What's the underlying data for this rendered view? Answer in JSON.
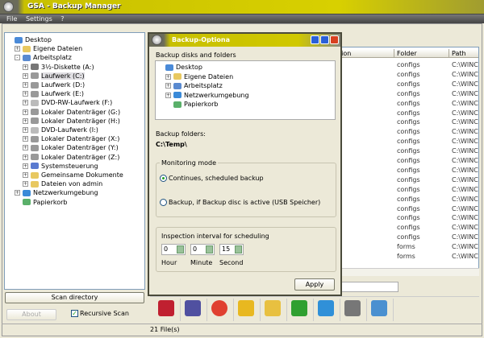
{
  "window": {
    "title": "GSA - Backup Manager"
  },
  "menu": [
    "File",
    "Settings",
    "?"
  ],
  "tree": [
    {
      "label": "Desktop",
      "level": 0,
      "expander": "",
      "icon": "desktop-icon",
      "color": "#4a8ad8"
    },
    {
      "label": "Eigene Dateien",
      "level": 1,
      "expander": "+",
      "icon": "folder-icon",
      "color": "#e8c860"
    },
    {
      "label": "Arbeitsplatz",
      "level": 1,
      "expander": "-",
      "icon": "computer-icon",
      "color": "#5a8ad0"
    },
    {
      "label": "3½-Diskette (A:)",
      "level": 2,
      "expander": "+",
      "icon": "floppy-icon",
      "color": "#777"
    },
    {
      "label": "Laufwerk (C:)",
      "level": 2,
      "expander": "+",
      "icon": "drive-icon",
      "color": "#999",
      "selected": true
    },
    {
      "label": "Laufwerk (D:)",
      "level": 2,
      "expander": "+",
      "icon": "drive-icon",
      "color": "#999"
    },
    {
      "label": "Laufwerk (E:)",
      "level": 2,
      "expander": "+",
      "icon": "drive-icon",
      "color": "#999"
    },
    {
      "label": "DVD-RW-Laufwerk (F:)",
      "level": 2,
      "expander": "+",
      "icon": "dvd-icon",
      "color": "#bbb"
    },
    {
      "label": "Lokaler Datenträger (G:)",
      "level": 2,
      "expander": "+",
      "icon": "drive-icon",
      "color": "#999"
    },
    {
      "label": "Lokaler Datenträger (H:)",
      "level": 2,
      "expander": "+",
      "icon": "drive-icon",
      "color": "#999"
    },
    {
      "label": "DVD-Laufwerk (I:)",
      "level": 2,
      "expander": "+",
      "icon": "dvd-icon",
      "color": "#bbb"
    },
    {
      "label": "Lokaler Datenträger (X:)",
      "level": 2,
      "expander": "+",
      "icon": "drive-icon",
      "color": "#999"
    },
    {
      "label": "Lokaler Datenträger (Y:)",
      "level": 2,
      "expander": "+",
      "icon": "drive-icon",
      "color": "#999"
    },
    {
      "label": "Lokaler Datenträger (Z:)",
      "level": 2,
      "expander": "+",
      "icon": "drive-icon",
      "color": "#999"
    },
    {
      "label": "Systemsteuerung",
      "level": 2,
      "expander": "+",
      "icon": "control-panel-icon",
      "color": "#5a7ad0"
    },
    {
      "label": "Gemeinsame Dokumente",
      "level": 2,
      "expander": "+",
      "icon": "folder-icon",
      "color": "#e8c860"
    },
    {
      "label": "Dateien von admin",
      "level": 2,
      "expander": "+",
      "icon": "folder-icon",
      "color": "#e8c860"
    },
    {
      "label": "Netzwerkumgebung",
      "level": 1,
      "expander": "+",
      "icon": "network-icon",
      "color": "#3a8ad8"
    },
    {
      "label": "Papierkorb",
      "level": 1,
      "expander": "",
      "icon": "recycle-bin-icon",
      "color": "#5ab06a"
    }
  ],
  "left_buttons": {
    "scan": "Scan directory",
    "about": "About",
    "recursive": "Recursive Scan",
    "recursive_checked": true
  },
  "list": {
    "columns": [
      "tion",
      "Folder",
      "Path"
    ],
    "rows_folder": [
      "configs",
      "configs",
      "configs",
      "configs",
      "configs",
      "configs",
      "configs",
      "configs",
      "configs",
      "configs",
      "configs",
      "configs",
      "configs",
      "configs",
      "configs",
      "configs",
      "configs",
      "configs",
      "configs",
      "forms",
      "forms"
    ],
    "path_value": "C:\\WINC"
  },
  "toolbar": [
    {
      "icon": "delete-selection-icon",
      "color": "#c02030"
    },
    {
      "icon": "compare-icon",
      "color": "#5050a0"
    },
    {
      "icon": "cancel-icon",
      "color": "#e04030"
    },
    {
      "icon": "restore-icon",
      "color": "#e8b820"
    },
    {
      "icon": "backup-icon",
      "color": "#e8c040"
    },
    {
      "icon": "download-icon",
      "color": "#30a030"
    },
    {
      "icon": "upload-icon",
      "color": "#3090d8"
    },
    {
      "icon": "folder-icon",
      "color": "#777"
    },
    {
      "icon": "usb-icon",
      "color": "#4a90d0"
    }
  ],
  "status": {
    "files": "21 File(s)"
  },
  "dialog": {
    "title": "Backup-Optiona",
    "disks_label": "Backup disks and folders",
    "tree": [
      {
        "label": "Desktop",
        "level": 0,
        "expander": "",
        "icon": "desktop-icon",
        "color": "#4a8ad8"
      },
      {
        "label": "Eigene Dateien",
        "level": 1,
        "expander": "+",
        "icon": "folder-icon",
        "color": "#e8c860"
      },
      {
        "label": "Arbeitsplatz",
        "level": 1,
        "expander": "+",
        "icon": "computer-icon",
        "color": "#5a8ad0"
      },
      {
        "label": "Netzwerkumgebung",
        "level": 1,
        "expander": "+",
        "icon": "network-icon",
        "color": "#3a8ad8"
      },
      {
        "label": "Papierkorb",
        "level": 1,
        "expander": "",
        "icon": "recycle-bin-icon",
        "color": "#5ab06a"
      }
    ],
    "folders_label": "Backup folders:",
    "folder_value": "C:\\Temp\\",
    "monitoring_label": "Monitoring mode",
    "mode_continuous": "Continues, scheduled backup",
    "mode_usb": "Backup, if Backup disc is active (USB Speicher)",
    "mode_selected": "continuous",
    "interval_label": "Inspection interval for scheduling",
    "hour": "0",
    "minute": "0",
    "second": "15",
    "hour_label": "Hour",
    "minute_label": "Minute",
    "second_label": "Second",
    "apply": "Apply"
  }
}
